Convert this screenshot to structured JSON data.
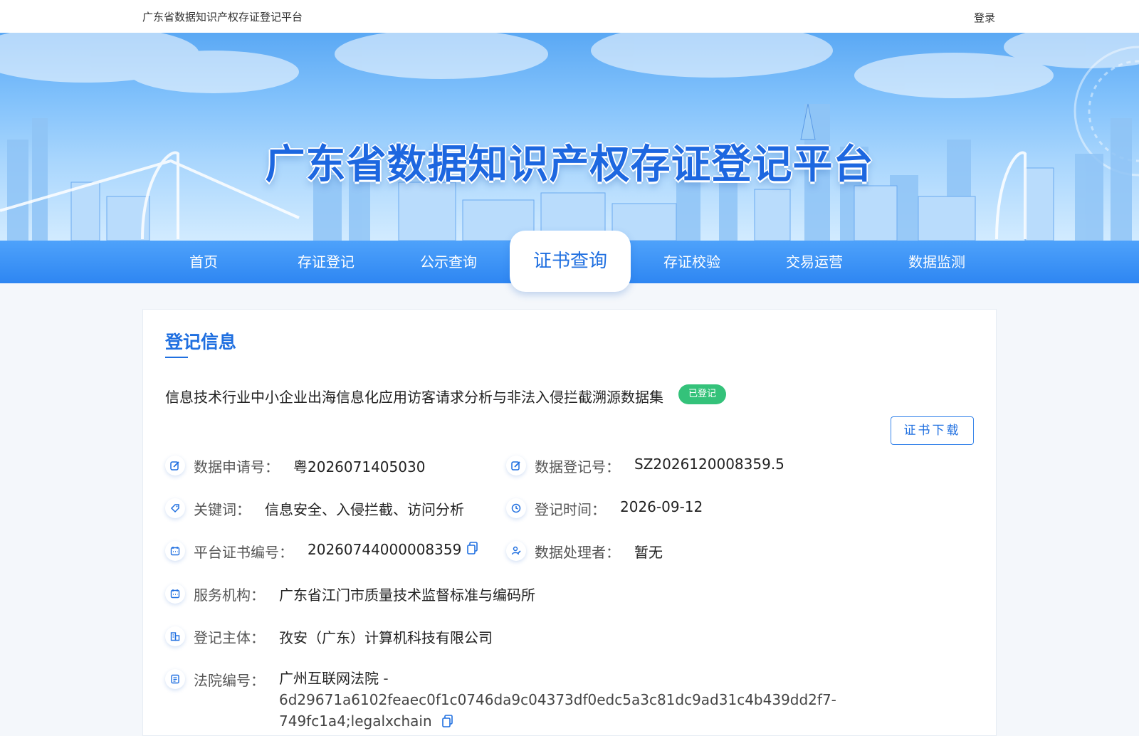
{
  "header": {
    "site_name": "广东省数据知识产权存证登记平台",
    "login": "登录"
  },
  "banner": {
    "title": "广东省数据知识产权存证登记平台"
  },
  "nav": {
    "items": [
      {
        "label": "首页"
      },
      {
        "label": "存证登记"
      },
      {
        "label": "公示查询"
      },
      {
        "label": "证书查询"
      },
      {
        "label": "存证校验"
      },
      {
        "label": "交易运营"
      },
      {
        "label": "数据监测"
      }
    ],
    "active_index": 3
  },
  "section": {
    "title": "登记信息",
    "item_title": "信息技术行业中小企业出海信息化应用访客请求分析与非法入侵拦截溯源数据集",
    "status": "已登记",
    "download_label": "证书下载"
  },
  "fields": {
    "apply_no": {
      "label": "数据申请号：",
      "value": "粤2026071405030",
      "icon": "edit-icon"
    },
    "reg_no": {
      "label": "数据登记号：",
      "value": "SZ2026120008359.5",
      "icon": "edit-icon"
    },
    "keywords": {
      "label": "关键词：",
      "value": "信息安全、入侵拦截、访问分析",
      "icon": "tag-icon"
    },
    "reg_time": {
      "label": "登记时间：",
      "value": "2026-09-12",
      "icon": "clock-icon"
    },
    "cert_no": {
      "label": "平台证书编号：",
      "value": "20260744000008359",
      "icon": "calendar-icon"
    },
    "processor": {
      "label": "数据处理者：",
      "value": "暂无",
      "icon": "user-edit-icon"
    },
    "agency": {
      "label": "服务机构：",
      "value": "广东省江门市质量技术监督标准与编码所",
      "icon": "calendar-icon"
    },
    "subject": {
      "label": "登记主体：",
      "value": "孜安（广东）计算机科技有限公司",
      "icon": "building-icon"
    },
    "court": {
      "label": "法院编号：",
      "court_name": "广州互联网法院",
      "hash_line1": " - 6d29671a6102feaec0f1c0746da9c04373df0edc5a3c81dc9ad31c4b439dd2f7-",
      "hash_line2": "749fc1a4;legalxchain",
      "icon": "document-icon"
    }
  },
  "colors": {
    "primary": "#1f6fe0",
    "nav": "#2e86f2",
    "badge": "#34c27a"
  }
}
